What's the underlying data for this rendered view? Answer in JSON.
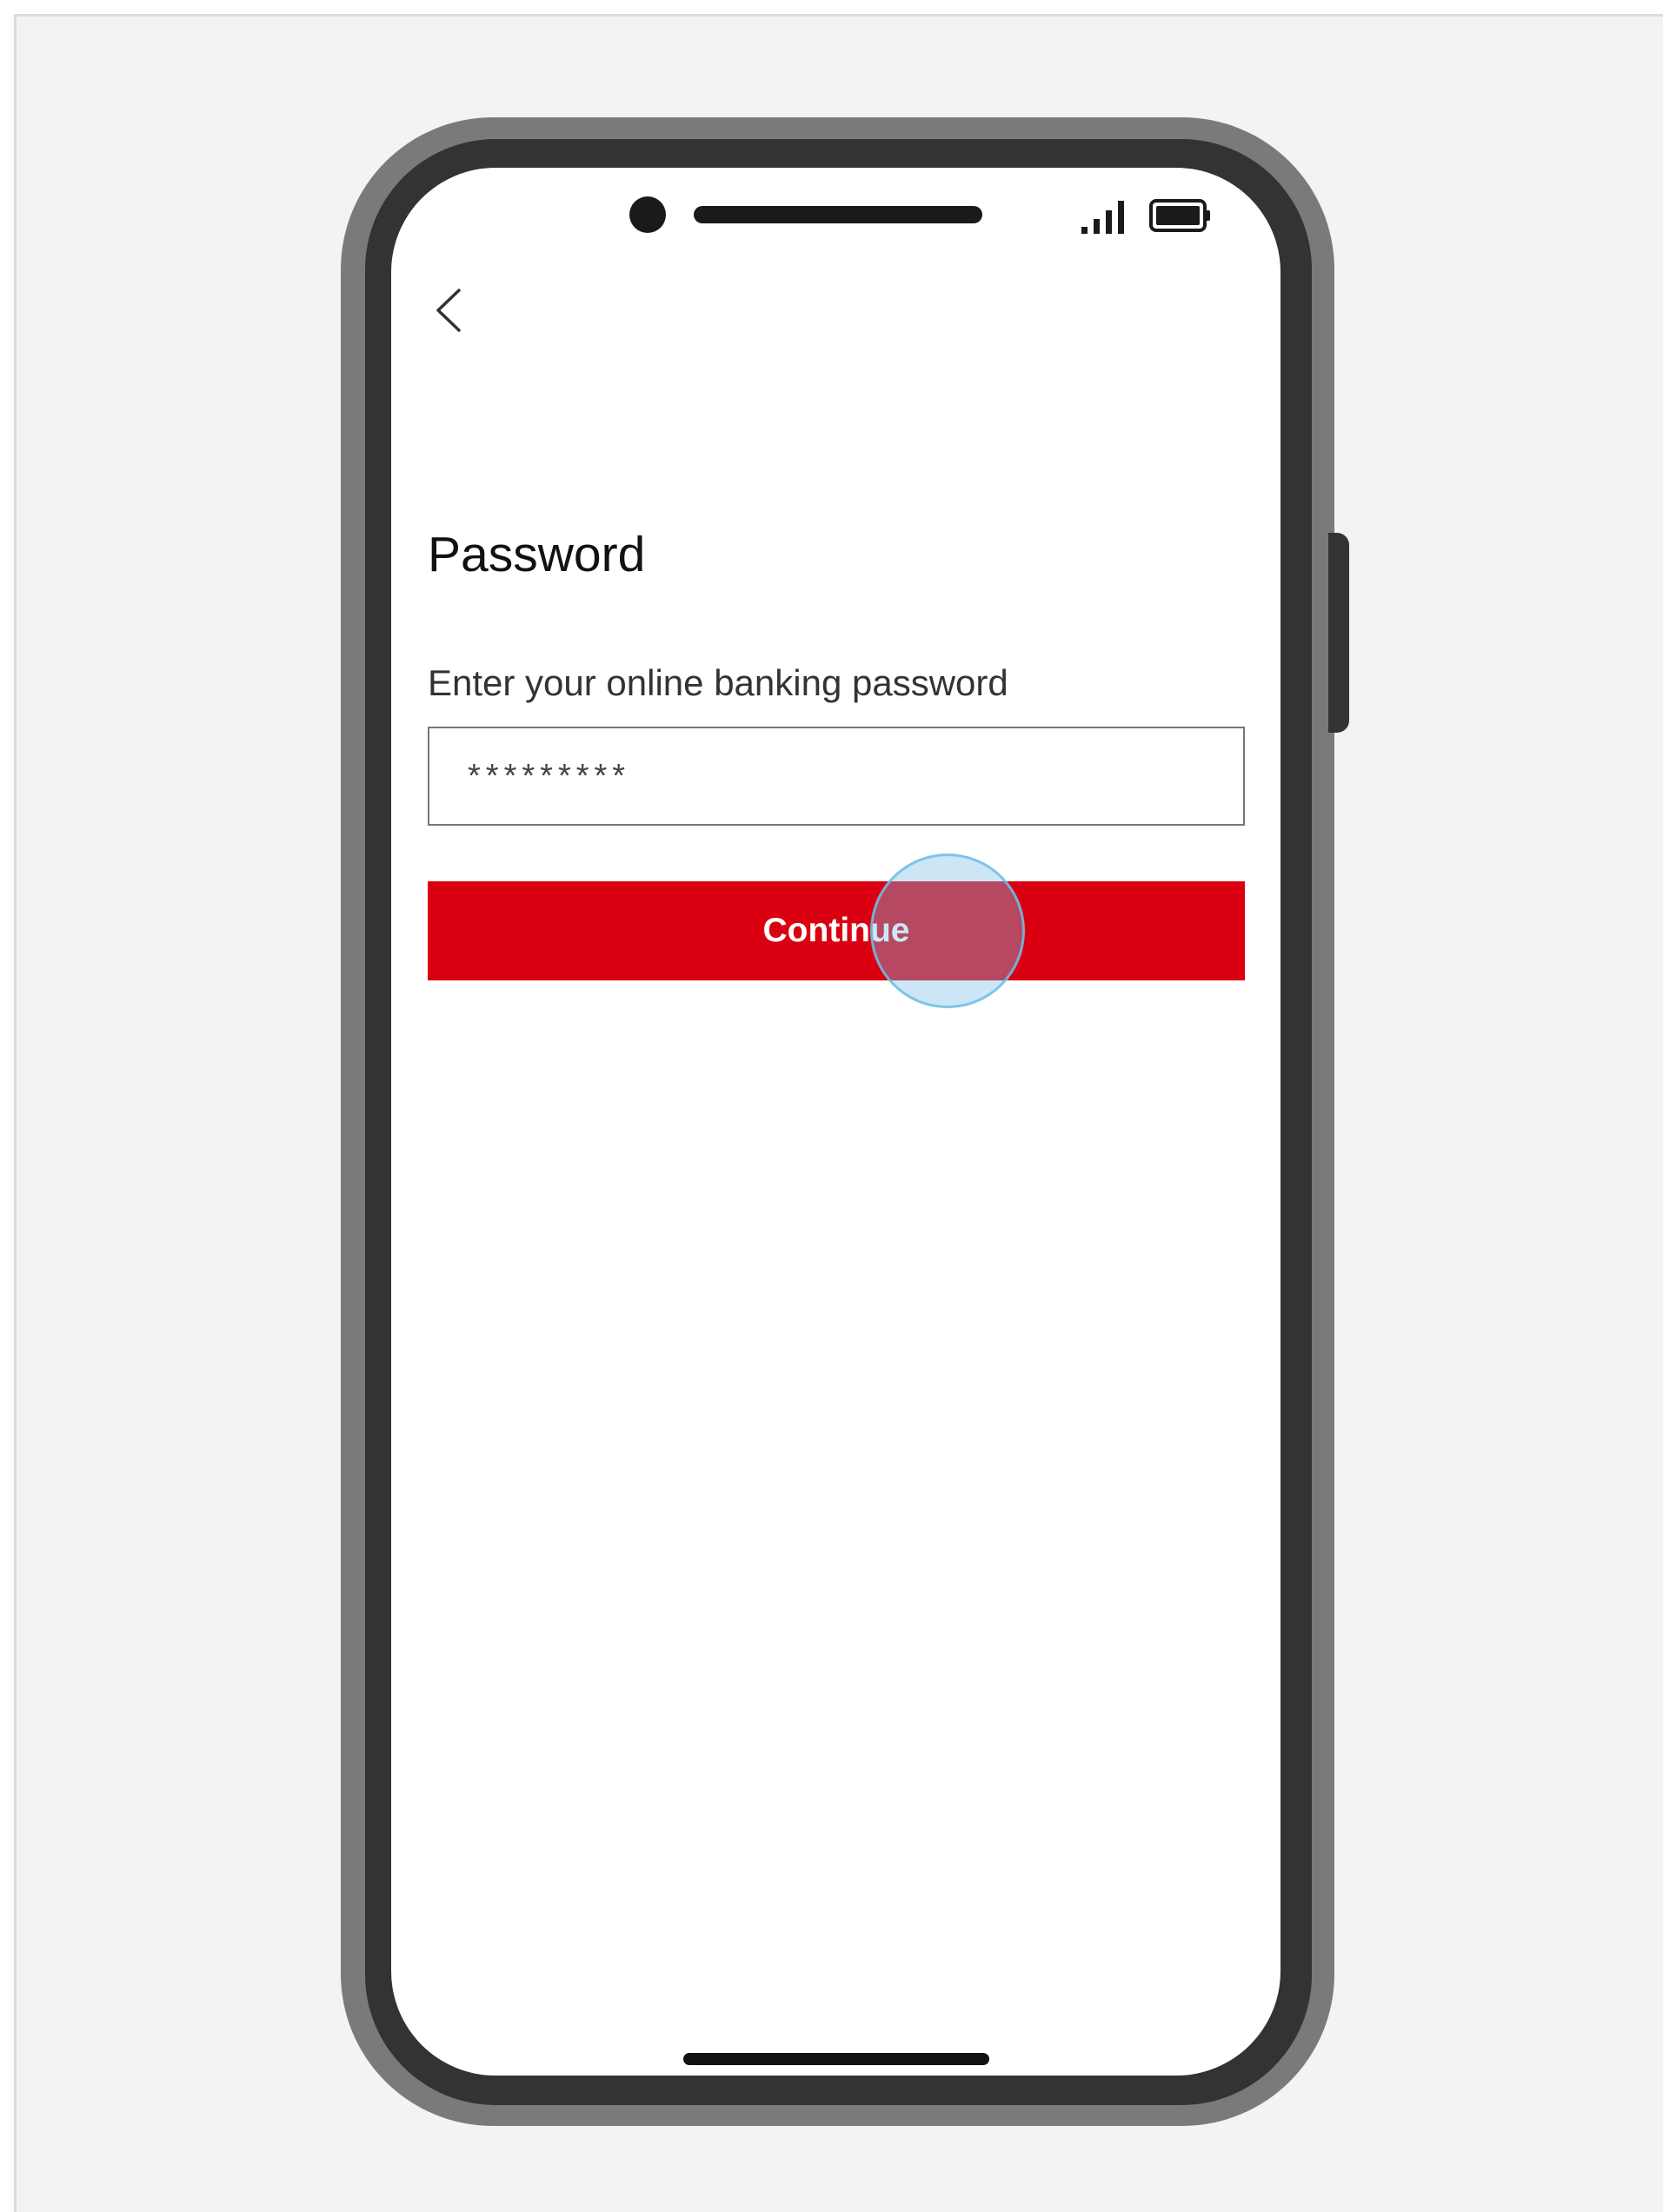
{
  "screen": {
    "title": "Password",
    "field_label": "Enter your online banking password",
    "password_value": "*********",
    "continue_label": "Continue"
  },
  "icons": {
    "back": "chevron-left-icon",
    "signal": "signal-icon",
    "battery": "battery-icon"
  },
  "colors": {
    "primary_button": "#db0011",
    "tap_indicator": "#7ec4ea"
  }
}
